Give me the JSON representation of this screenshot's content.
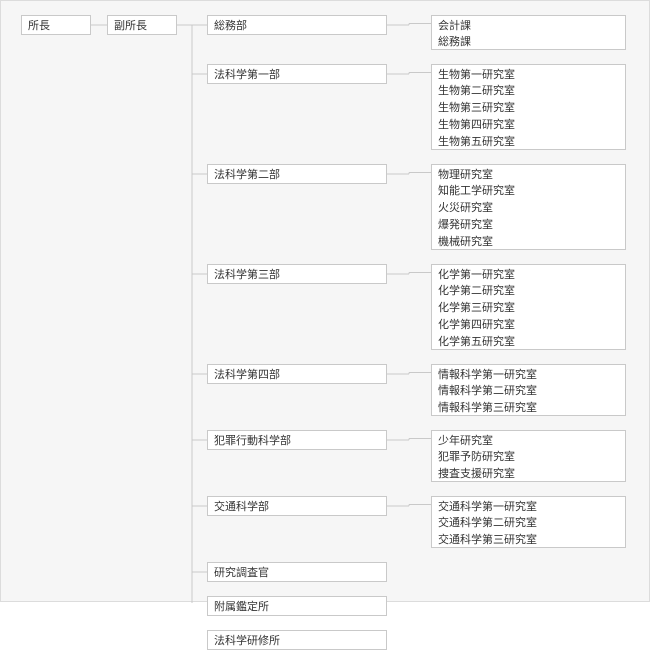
{
  "root": {
    "label": "所長",
    "child": {
      "label": "副所長",
      "departments": [
        {
          "label": "総務部",
          "subs": [
            "会計課",
            "総務課"
          ]
        },
        {
          "label": "法科学第一部",
          "subs": [
            "生物第一研究室",
            "生物第二研究室",
            "生物第三研究室",
            "生物第四研究室",
            "生物第五研究室"
          ]
        },
        {
          "label": "法科学第二部",
          "subs": [
            "物理研究室",
            "知能工学研究室",
            "火災研究室",
            "爆発研究室",
            "機械研究室"
          ]
        },
        {
          "label": "法科学第三部",
          "subs": [
            "化学第一研究室",
            "化学第二研究室",
            "化学第三研究室",
            "化学第四研究室",
            "化学第五研究室"
          ]
        },
        {
          "label": "法科学第四部",
          "subs": [
            "情報科学第一研究室",
            "情報科学第二研究室",
            "情報科学第三研究室"
          ]
        },
        {
          "label": "犯罪行動科学部",
          "subs": [
            "少年研究室",
            "犯罪予防研究室",
            "捜査支援研究室"
          ]
        },
        {
          "label": "交通科学部",
          "subs": [
            "交通科学第一研究室",
            "交通科学第二研究室",
            "交通科学第三研究室"
          ]
        },
        {
          "label": "研究調査官",
          "subs": []
        },
        {
          "label": "附属鑑定所",
          "subs": []
        },
        {
          "label": "法科学研修所",
          "subs": []
        }
      ]
    }
  },
  "chart_data": {
    "type": "tree",
    "title": "",
    "nodes": [
      {
        "id": "director",
        "label": "所長",
        "parent": null
      },
      {
        "id": "deputy",
        "label": "副所長",
        "parent": "director"
      },
      {
        "id": "d0",
        "label": "総務部",
        "parent": "deputy"
      },
      {
        "id": "d0s0",
        "label": "会計課",
        "parent": "d0"
      },
      {
        "id": "d0s1",
        "label": "総務課",
        "parent": "d0"
      },
      {
        "id": "d1",
        "label": "法科学第一部",
        "parent": "deputy"
      },
      {
        "id": "d1s0",
        "label": "生物第一研究室",
        "parent": "d1"
      },
      {
        "id": "d1s1",
        "label": "生物第二研究室",
        "parent": "d1"
      },
      {
        "id": "d1s2",
        "label": "生物第三研究室",
        "parent": "d1"
      },
      {
        "id": "d1s3",
        "label": "生物第四研究室",
        "parent": "d1"
      },
      {
        "id": "d1s4",
        "label": "生物第五研究室",
        "parent": "d1"
      },
      {
        "id": "d2",
        "label": "法科学第二部",
        "parent": "deputy"
      },
      {
        "id": "d2s0",
        "label": "物理研究室",
        "parent": "d2"
      },
      {
        "id": "d2s1",
        "label": "知能工学研究室",
        "parent": "d2"
      },
      {
        "id": "d2s2",
        "label": "火災研究室",
        "parent": "d2"
      },
      {
        "id": "d2s3",
        "label": "爆発研究室",
        "parent": "d2"
      },
      {
        "id": "d2s4",
        "label": "機械研究室",
        "parent": "d2"
      },
      {
        "id": "d3",
        "label": "法科学第三部",
        "parent": "deputy"
      },
      {
        "id": "d3s0",
        "label": "化学第一研究室",
        "parent": "d3"
      },
      {
        "id": "d3s1",
        "label": "化学第二研究室",
        "parent": "d3"
      },
      {
        "id": "d3s2",
        "label": "化学第三研究室",
        "parent": "d3"
      },
      {
        "id": "d3s3",
        "label": "化学第四研究室",
        "parent": "d3"
      },
      {
        "id": "d3s4",
        "label": "化学第五研究室",
        "parent": "d3"
      },
      {
        "id": "d4",
        "label": "法科学第四部",
        "parent": "deputy"
      },
      {
        "id": "d4s0",
        "label": "情報科学第一研究室",
        "parent": "d4"
      },
      {
        "id": "d4s1",
        "label": "情報科学第二研究室",
        "parent": "d4"
      },
      {
        "id": "d4s2",
        "label": "情報科学第三研究室",
        "parent": "d4"
      },
      {
        "id": "d5",
        "label": "犯罪行動科学部",
        "parent": "deputy"
      },
      {
        "id": "d5s0",
        "label": "少年研究室",
        "parent": "d5"
      },
      {
        "id": "d5s1",
        "label": "犯罪予防研究室",
        "parent": "d5"
      },
      {
        "id": "d5s2",
        "label": "捜査支援研究室",
        "parent": "d5"
      },
      {
        "id": "d6",
        "label": "交通科学部",
        "parent": "deputy"
      },
      {
        "id": "d6s0",
        "label": "交通科学第一研究室",
        "parent": "d6"
      },
      {
        "id": "d6s1",
        "label": "交通科学第二研究室",
        "parent": "d6"
      },
      {
        "id": "d6s2",
        "label": "交通科学第三研究室",
        "parent": "d6"
      },
      {
        "id": "d7",
        "label": "研究調査官",
        "parent": "deputy"
      },
      {
        "id": "d8",
        "label": "附属鑑定所",
        "parent": "deputy"
      },
      {
        "id": "d9",
        "label": "法科学研修所",
        "parent": "deputy"
      }
    ]
  }
}
